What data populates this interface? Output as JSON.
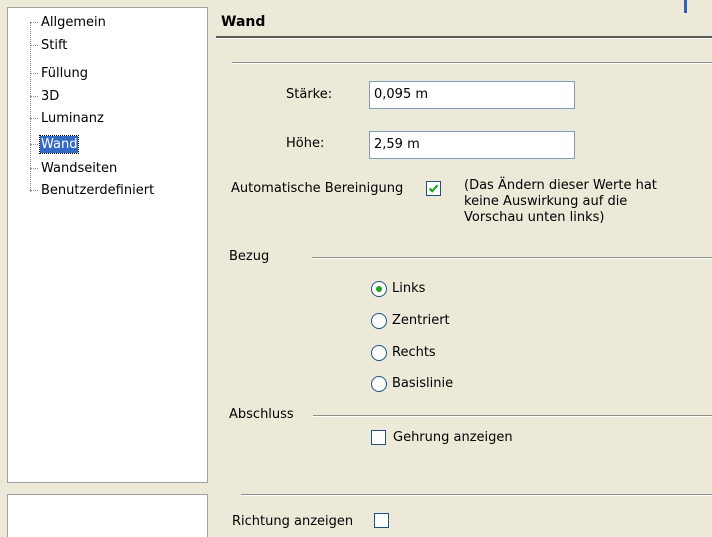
{
  "tree": {
    "items": [
      {
        "label": "Allgemein"
      },
      {
        "label": "Stift"
      },
      {
        "label": "Füllung"
      },
      {
        "label": "3D"
      },
      {
        "label": "Luminanz"
      },
      {
        "label": "Wand"
      },
      {
        "label": "Wandseiten"
      },
      {
        "label": "Benutzerdefiniert"
      }
    ],
    "selected": "Wand"
  },
  "panel": {
    "title": "Wand",
    "staerke_label": "Stärke:",
    "staerke_value": "0,095 m",
    "hoehe_label": "Höhe:",
    "hoehe_value": "2,59 m",
    "auto_label": "Automatische Bereinigung",
    "auto_checked": true,
    "note": "(Das Ändern dieser Werte hat keine Auswirkung auf die Vorschau unten links)",
    "bezug_label": "Bezug",
    "radios": [
      {
        "label": "Links",
        "checked": true
      },
      {
        "label": "Zentriert",
        "checked": false
      },
      {
        "label": "Rechts",
        "checked": false
      },
      {
        "label": "Basislinie",
        "checked": false
      }
    ],
    "abschluss_label": "Abschluss",
    "gehrung_label": "Gehrung anzeigen",
    "gehrung_checked": false,
    "richtung_label": "Richtung anzeigen",
    "richtung_checked": false
  },
  "colors": {
    "selection": "#316ac5",
    "check": "#21a121",
    "field_border": "#7f9db9"
  }
}
